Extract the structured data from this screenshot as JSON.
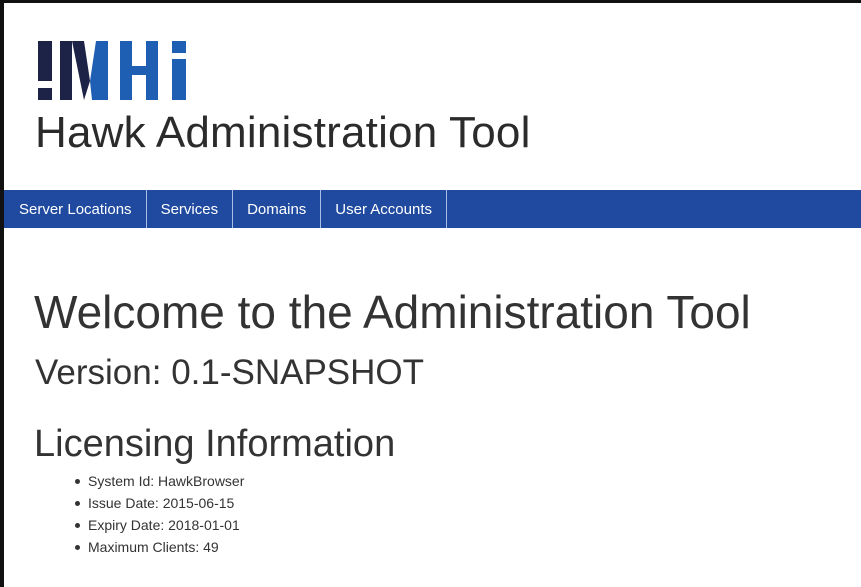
{
  "logo": {
    "text": "!MHi",
    "colors": {
      "dark": "#1d2247",
      "blue": "#1f5fb3"
    }
  },
  "app": {
    "title": "Hawk Administration Tool"
  },
  "nav": {
    "background": "#1f4aa0",
    "items": [
      {
        "label": "Server Locations"
      },
      {
        "label": "Services"
      },
      {
        "label": "Domains"
      },
      {
        "label": "User Accounts"
      }
    ]
  },
  "main": {
    "welcome": "Welcome to the Administration Tool",
    "version": "Version: 0.1-SNAPSHOT",
    "licensing": {
      "heading": "Licensing Information",
      "items": [
        "System Id: HawkBrowser",
        "Issue Date: 2015-06-15",
        "Expiry Date: 2018-01-01",
        "Maximum Clients: 49"
      ]
    }
  }
}
